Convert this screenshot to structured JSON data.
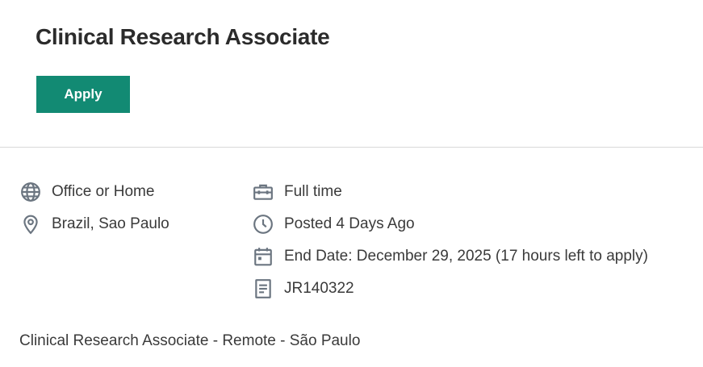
{
  "header": {
    "title": "Clinical Research Associate",
    "apply_label": "Apply"
  },
  "details": {
    "work_type": {
      "icon": "globe-icon",
      "text": "Office or Home"
    },
    "location": {
      "icon": "location-pin-icon",
      "text": "Brazil, Sao Paulo"
    },
    "employment_type": {
      "icon": "briefcase-icon",
      "text": "Full time"
    },
    "posted": {
      "icon": "clock-icon",
      "text": "Posted 4 Days Ago"
    },
    "end_date": {
      "icon": "calendar-icon",
      "text": "End Date: December 29, 2025 (17 hours left to apply)"
    },
    "requisition_id": {
      "icon": "document-icon",
      "text": "JR140322"
    }
  },
  "description": {
    "subtitle": "Clinical Research Associate - Remote - São Paulo"
  },
  "colors": {
    "accent": "#128a73",
    "icon": "#6b7580",
    "text": "#3a3a3a",
    "divider": "#d9d9d9"
  }
}
